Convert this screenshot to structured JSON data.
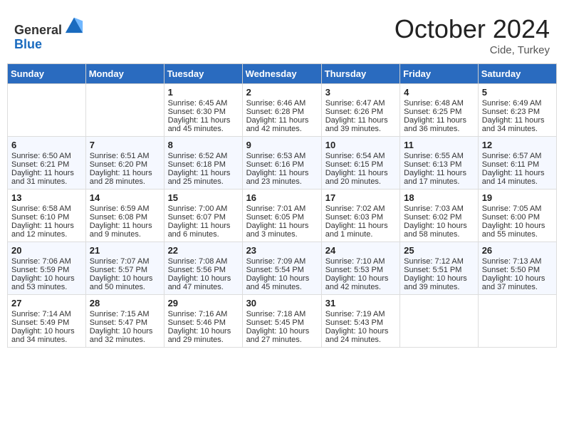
{
  "header": {
    "logo_general": "General",
    "logo_blue": "Blue",
    "month_title": "October 2024",
    "location": "Cide, Turkey"
  },
  "days_of_week": [
    "Sunday",
    "Monday",
    "Tuesday",
    "Wednesday",
    "Thursday",
    "Friday",
    "Saturday"
  ],
  "weeks": [
    [
      {
        "day": "",
        "sunrise": "",
        "sunset": "",
        "daylight": ""
      },
      {
        "day": "",
        "sunrise": "",
        "sunset": "",
        "daylight": ""
      },
      {
        "day": "1",
        "sunrise": "Sunrise: 6:45 AM",
        "sunset": "Sunset: 6:30 PM",
        "daylight": "Daylight: 11 hours and 45 minutes."
      },
      {
        "day": "2",
        "sunrise": "Sunrise: 6:46 AM",
        "sunset": "Sunset: 6:28 PM",
        "daylight": "Daylight: 11 hours and 42 minutes."
      },
      {
        "day": "3",
        "sunrise": "Sunrise: 6:47 AM",
        "sunset": "Sunset: 6:26 PM",
        "daylight": "Daylight: 11 hours and 39 minutes."
      },
      {
        "day": "4",
        "sunrise": "Sunrise: 6:48 AM",
        "sunset": "Sunset: 6:25 PM",
        "daylight": "Daylight: 11 hours and 36 minutes."
      },
      {
        "day": "5",
        "sunrise": "Sunrise: 6:49 AM",
        "sunset": "Sunset: 6:23 PM",
        "daylight": "Daylight: 11 hours and 34 minutes."
      }
    ],
    [
      {
        "day": "6",
        "sunrise": "Sunrise: 6:50 AM",
        "sunset": "Sunset: 6:21 PM",
        "daylight": "Daylight: 11 hours and 31 minutes."
      },
      {
        "day": "7",
        "sunrise": "Sunrise: 6:51 AM",
        "sunset": "Sunset: 6:20 PM",
        "daylight": "Daylight: 11 hours and 28 minutes."
      },
      {
        "day": "8",
        "sunrise": "Sunrise: 6:52 AM",
        "sunset": "Sunset: 6:18 PM",
        "daylight": "Daylight: 11 hours and 25 minutes."
      },
      {
        "day": "9",
        "sunrise": "Sunrise: 6:53 AM",
        "sunset": "Sunset: 6:16 PM",
        "daylight": "Daylight: 11 hours and 23 minutes."
      },
      {
        "day": "10",
        "sunrise": "Sunrise: 6:54 AM",
        "sunset": "Sunset: 6:15 PM",
        "daylight": "Daylight: 11 hours and 20 minutes."
      },
      {
        "day": "11",
        "sunrise": "Sunrise: 6:55 AM",
        "sunset": "Sunset: 6:13 PM",
        "daylight": "Daylight: 11 hours and 17 minutes."
      },
      {
        "day": "12",
        "sunrise": "Sunrise: 6:57 AM",
        "sunset": "Sunset: 6:11 PM",
        "daylight": "Daylight: 11 hours and 14 minutes."
      }
    ],
    [
      {
        "day": "13",
        "sunrise": "Sunrise: 6:58 AM",
        "sunset": "Sunset: 6:10 PM",
        "daylight": "Daylight: 11 hours and 12 minutes."
      },
      {
        "day": "14",
        "sunrise": "Sunrise: 6:59 AM",
        "sunset": "Sunset: 6:08 PM",
        "daylight": "Daylight: 11 hours and 9 minutes."
      },
      {
        "day": "15",
        "sunrise": "Sunrise: 7:00 AM",
        "sunset": "Sunset: 6:07 PM",
        "daylight": "Daylight: 11 hours and 6 minutes."
      },
      {
        "day": "16",
        "sunrise": "Sunrise: 7:01 AM",
        "sunset": "Sunset: 6:05 PM",
        "daylight": "Daylight: 11 hours and 3 minutes."
      },
      {
        "day": "17",
        "sunrise": "Sunrise: 7:02 AM",
        "sunset": "Sunset: 6:03 PM",
        "daylight": "Daylight: 11 hours and 1 minute."
      },
      {
        "day": "18",
        "sunrise": "Sunrise: 7:03 AM",
        "sunset": "Sunset: 6:02 PM",
        "daylight": "Daylight: 10 hours and 58 minutes."
      },
      {
        "day": "19",
        "sunrise": "Sunrise: 7:05 AM",
        "sunset": "Sunset: 6:00 PM",
        "daylight": "Daylight: 10 hours and 55 minutes."
      }
    ],
    [
      {
        "day": "20",
        "sunrise": "Sunrise: 7:06 AM",
        "sunset": "Sunset: 5:59 PM",
        "daylight": "Daylight: 10 hours and 53 minutes."
      },
      {
        "day": "21",
        "sunrise": "Sunrise: 7:07 AM",
        "sunset": "Sunset: 5:57 PM",
        "daylight": "Daylight: 10 hours and 50 minutes."
      },
      {
        "day": "22",
        "sunrise": "Sunrise: 7:08 AM",
        "sunset": "Sunset: 5:56 PM",
        "daylight": "Daylight: 10 hours and 47 minutes."
      },
      {
        "day": "23",
        "sunrise": "Sunrise: 7:09 AM",
        "sunset": "Sunset: 5:54 PM",
        "daylight": "Daylight: 10 hours and 45 minutes."
      },
      {
        "day": "24",
        "sunrise": "Sunrise: 7:10 AM",
        "sunset": "Sunset: 5:53 PM",
        "daylight": "Daylight: 10 hours and 42 minutes."
      },
      {
        "day": "25",
        "sunrise": "Sunrise: 7:12 AM",
        "sunset": "Sunset: 5:51 PM",
        "daylight": "Daylight: 10 hours and 39 minutes."
      },
      {
        "day": "26",
        "sunrise": "Sunrise: 7:13 AM",
        "sunset": "Sunset: 5:50 PM",
        "daylight": "Daylight: 10 hours and 37 minutes."
      }
    ],
    [
      {
        "day": "27",
        "sunrise": "Sunrise: 7:14 AM",
        "sunset": "Sunset: 5:49 PM",
        "daylight": "Daylight: 10 hours and 34 minutes."
      },
      {
        "day": "28",
        "sunrise": "Sunrise: 7:15 AM",
        "sunset": "Sunset: 5:47 PM",
        "daylight": "Daylight: 10 hours and 32 minutes."
      },
      {
        "day": "29",
        "sunrise": "Sunrise: 7:16 AM",
        "sunset": "Sunset: 5:46 PM",
        "daylight": "Daylight: 10 hours and 29 minutes."
      },
      {
        "day": "30",
        "sunrise": "Sunrise: 7:18 AM",
        "sunset": "Sunset: 5:45 PM",
        "daylight": "Daylight: 10 hours and 27 minutes."
      },
      {
        "day": "31",
        "sunrise": "Sunrise: 7:19 AM",
        "sunset": "Sunset: 5:43 PM",
        "daylight": "Daylight: 10 hours and 24 minutes."
      },
      {
        "day": "",
        "sunrise": "",
        "sunset": "",
        "daylight": ""
      },
      {
        "day": "",
        "sunrise": "",
        "sunset": "",
        "daylight": ""
      }
    ]
  ]
}
